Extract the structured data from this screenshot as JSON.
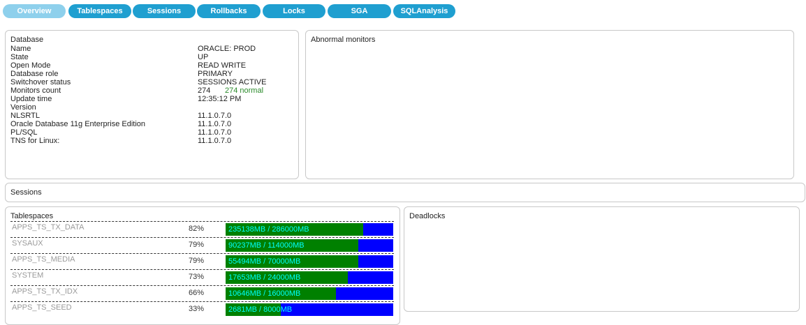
{
  "tabs": [
    {
      "label": "Overview",
      "active": true
    },
    {
      "label": "Tablespaces",
      "active": false
    },
    {
      "label": "Sessions",
      "active": false
    },
    {
      "label": "Rollbacks",
      "active": false
    },
    {
      "label": "Locks",
      "active": false
    },
    {
      "label": "SGA",
      "active": false
    },
    {
      "label": "SQLAnalysis",
      "active": false
    }
  ],
  "database": {
    "title": "Database",
    "name_label": "Name",
    "name_value": "ORACLE: PROD",
    "state_label": "State",
    "state_value": "UP",
    "open_mode_label": "Open Mode",
    "open_mode_value": "READ WRITE",
    "role_label": "Database role",
    "role_value": "PRIMARY",
    "switchover_label": "Switchover status",
    "switchover_value": "SESSIONS ACTIVE",
    "monitors_label": "Monitors count",
    "monitors_value": "274",
    "monitors_normal": "274 normal",
    "update_label": "Update time",
    "update_value": "12:35:12 PM",
    "version_label": "Version",
    "versions": [
      {
        "name": "NLSRTL",
        "value": "11.1.0.7.0"
      },
      {
        "name": "Oracle Database 11g Enterprise Edition",
        "value": "11.1.0.7.0"
      },
      {
        "name": "PL/SQL",
        "value": "11.1.0.7.0"
      },
      {
        "name": "TNS for Linux:",
        "value": "11.1.0.7.0"
      }
    ]
  },
  "abnormal": {
    "title": "Abnormal monitors"
  },
  "sessions": {
    "title": "Sessions"
  },
  "tablespaces": {
    "title": "Tablespaces",
    "rows": [
      {
        "name": "APPS_TS_TX_DATA",
        "percent": "82%",
        "usage": "235138MB / 286000MB",
        "fraction": 0.82
      },
      {
        "name": "SYSAUX",
        "percent": "79%",
        "usage": "90237MB / 114000MB",
        "fraction": 0.79
      },
      {
        "name": "APPS_TS_MEDIA",
        "percent": "79%",
        "usage": "55494MB / 70000MB",
        "fraction": 0.79
      },
      {
        "name": "SYSTEM",
        "percent": "73%",
        "usage": "17653MB / 24000MB",
        "fraction": 0.73
      },
      {
        "name": "APPS_TS_TX_IDX",
        "percent": "66%",
        "usage": "10646MB / 16000MB",
        "fraction": 0.66
      },
      {
        "name": "APPS_TS_SEED",
        "percent": "33%",
        "usage": "2681MB / 8000MB",
        "fraction": 0.33
      }
    ]
  },
  "deadlocks": {
    "title": "Deadlocks"
  },
  "colors": {
    "used": "#008000",
    "free": "#0000ff",
    "usage_text": "#00ffff",
    "tab": "#1f9fd0",
    "tab_active": "#8ed0ec",
    "normal_text": "#2a8a2a"
  }
}
